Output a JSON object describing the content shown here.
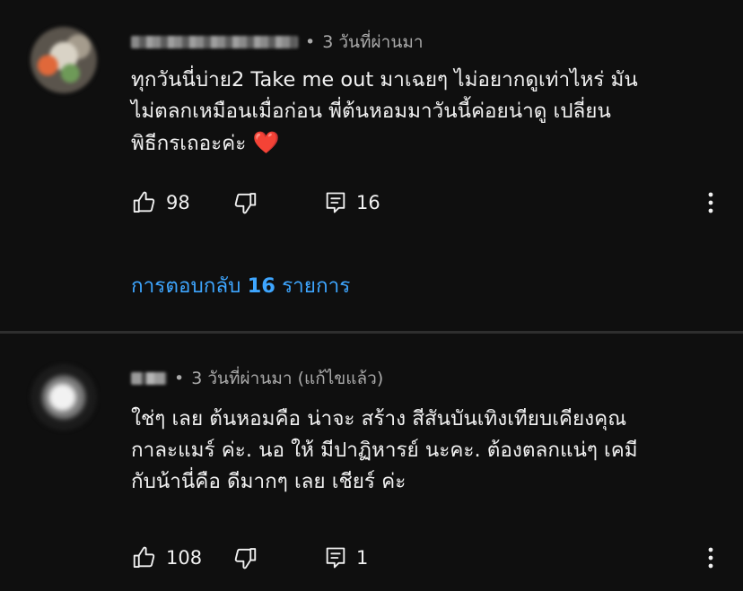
{
  "comments": [
    {
      "time": "3 วันที่ผ่านมา",
      "edited": "",
      "lines": [
        "ทุกวันนี่บ่าย2 Take me out มาเฉยๆ ไม่อยากดูเท่าไหร่ มัน",
        "ไม่ตลกเหมือนเมื่อก่อน พี่ต้นหอมมาวันนี้ค่อยน่าดู เปลี่ยน",
        "พิธีกรเถอะค่ะ"
      ],
      "emoji": "❤️",
      "likes": "98",
      "replies": "16",
      "replies_link": {
        "prefix": "การตอบกลับ",
        "count": "16",
        "suffix": "รายการ"
      }
    },
    {
      "time": "3 วันที่ผ่านมา",
      "edited": "(แก้ไขแล้ว)",
      "lines": [
        "ใช่ๆ เลย ต้นหอมคือ น่าจะ สร้าง สีสันบันเทิงเทียบเคียงคุณ",
        "กาละแมร์ ค่ะ. นอ ให้ มีปาฏิหารย์ นะคะ. ต้องตลกแน่ๆ เคมี",
        "กับน้านี่คือ ดีมากๆ เลย เชียร์ ค่ะ"
      ],
      "likes": "108",
      "replies": "1"
    }
  ],
  "meta_separator": "•",
  "icons": {
    "like": "thumbs-up-icon",
    "dislike": "thumbs-down-icon",
    "reply": "comment-reply-icon",
    "more": "more-vertical-icon"
  },
  "colors": {
    "background": "#0f0f0f",
    "text": "#f1f1f1",
    "secondary_text": "#aaaaaa",
    "link": "#3ea6ff",
    "divider": "#2e2e2e"
  }
}
